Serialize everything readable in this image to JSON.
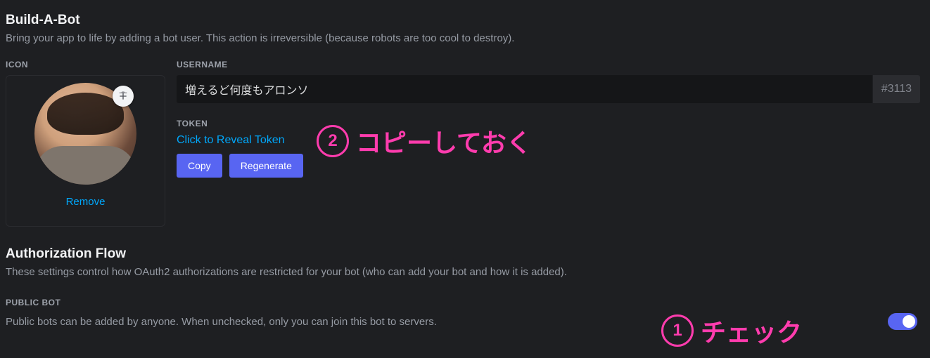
{
  "sections": {
    "build": {
      "title": "Build-A-Bot",
      "subtitle": "Bring your app to life by adding a bot user. This action is irreversible (because robots are too cool to destroy)."
    },
    "auth": {
      "title": "Authorization Flow",
      "subtitle": "These settings control how OAuth2 authorizations are restricted for your bot (who can add your bot and how it is added)."
    }
  },
  "labels": {
    "icon": "ICON",
    "username": "USERNAME",
    "token": "TOKEN",
    "public_bot": "PUBLIC BOT"
  },
  "icon_panel": {
    "remove": "Remove"
  },
  "username": {
    "value": "増えるど何度もアロンソ",
    "discriminator": "#3113"
  },
  "token": {
    "reveal": "Click to Reveal Token",
    "copy": "Copy",
    "regenerate": "Regenerate"
  },
  "public_bot": {
    "description": "Public bots can be added by anyone. When unchecked, only you can join this bot to servers.",
    "checked": true
  },
  "annotations": {
    "step1": {
      "num": "1",
      "text": "チェック"
    },
    "step2": {
      "num": "2",
      "text": "コピーしておく"
    }
  },
  "colors": {
    "accent": "#5865f2",
    "link": "#00a8fc",
    "annotation": "#ff3cae"
  }
}
